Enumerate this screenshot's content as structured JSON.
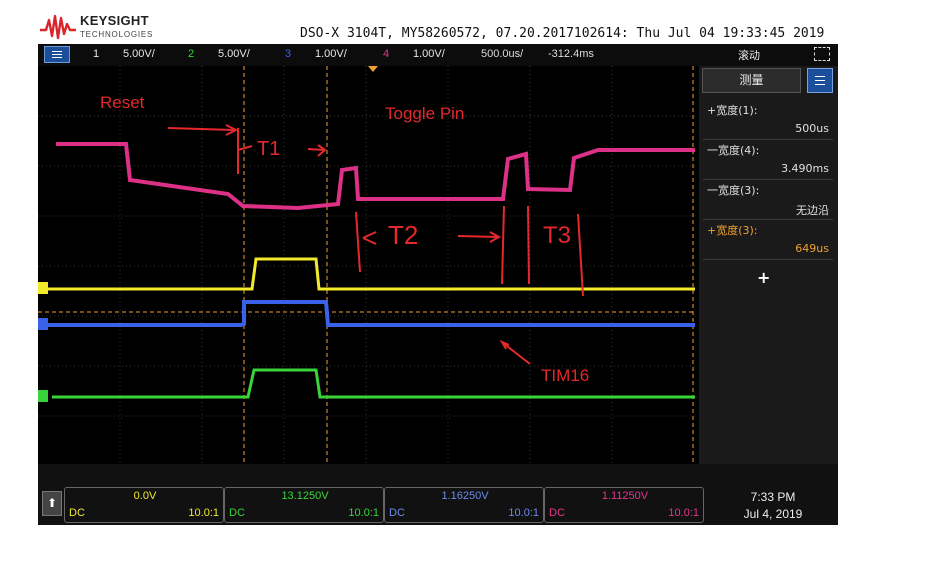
{
  "brand": {
    "name": "KEYSIGHT",
    "sub": "TECHNOLOGIES"
  },
  "window": {
    "title": "DSO-X 3104T, MY58260572, 07.20.2017102614: Thu Jul 04 19:33:45 2019"
  },
  "status_bar": {
    "channels": [
      {
        "num": "1",
        "scale": "5.00V/",
        "color": "#f2ea2a"
      },
      {
        "num": "2",
        "scale": "5.00V/",
        "color": "#39d43a"
      },
      {
        "num": "3",
        "scale": "1.00V/",
        "color": "#3a62e8"
      },
      {
        "num": "4",
        "scale": "1.00V/",
        "color": "#e9348f"
      }
    ],
    "timebase": "500.0us/",
    "delay": "-312.4ms",
    "mode": "滚动",
    "menu_icon": "menu-icon",
    "cursor_icon": "cursor-icon"
  },
  "annotations": {
    "reset": "Reset",
    "toggle": "Toggle Pin",
    "t1": "T1",
    "t2": "T2",
    "t3": "T3",
    "tim16": "TIM16"
  },
  "panel": {
    "tab": "测量",
    "measurements": [
      {
        "name": "+宽度(1):",
        "value": "500us",
        "color": "#e0e0e0"
      },
      {
        "name": "一宽度(4):",
        "value": "3.490ms",
        "color": "#e0e0e0"
      },
      {
        "name": "一宽度(3):",
        "value": "无边沿",
        "color": "#e0e0e0"
      },
      {
        "name": "+宽度(3):",
        "value": "649us",
        "color": "#f0a030"
      }
    ],
    "add_label": "+"
  },
  "bottom_bar": {
    "home_icon": "up-arrow-icon",
    "home_label": "⬆",
    "channels": [
      {
        "value": "0.0V",
        "coupling": "DC",
        "probe": "10.0:1",
        "color": "#f2ea2a"
      },
      {
        "value": "13.1250V",
        "coupling": "DC",
        "probe": "10.0:1",
        "color": "#39d43a"
      },
      {
        "value": "1.16250V",
        "coupling": "DC",
        "probe": "10.0:1",
        "color": "#3a62e8"
      },
      {
        "value": "1.11250V",
        "coupling": "DC",
        "probe": "10.0:1",
        "color": "#e9348f"
      }
    ],
    "time": "7:33 PM",
    "date": "Jul 4, 2019"
  }
}
